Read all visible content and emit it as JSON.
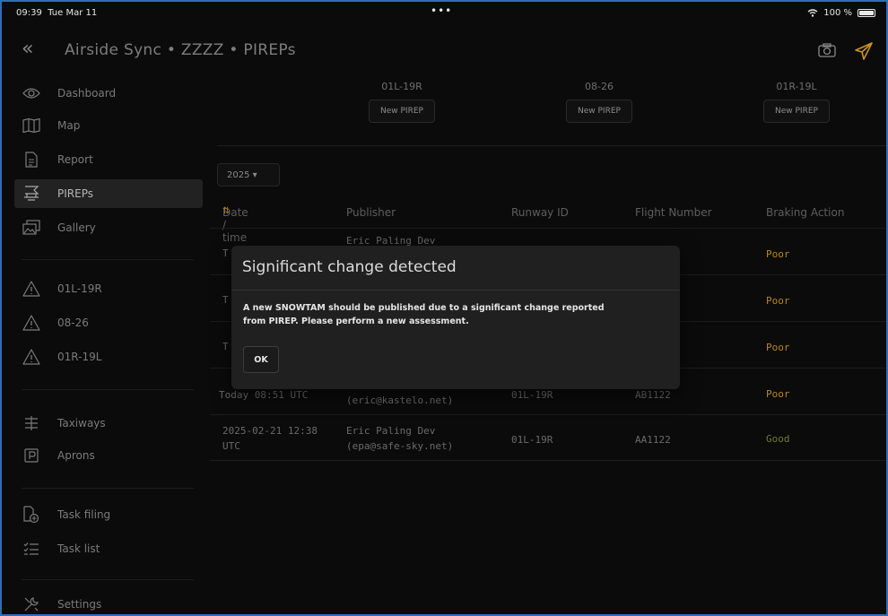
{
  "status": {
    "time": "09:39",
    "date": "Tue Mar 11",
    "dots": "•••",
    "battery": "100 %"
  },
  "nav": {
    "title": "Airside Sync • ZZZZ • PIREPs"
  },
  "sidebar": {
    "items": [
      {
        "label": "Dashboard",
        "icon": "eye-icon"
      },
      {
        "label": "Map",
        "icon": "map-icon"
      },
      {
        "label": "Report",
        "icon": "report-icon"
      },
      {
        "label": "PIREPs",
        "icon": "pirep-icon",
        "active": true
      },
      {
        "label": "Gallery",
        "icon": "gallery-icon"
      },
      {
        "label": "01L-19R",
        "icon": "warning-icon"
      },
      {
        "label": "08-26",
        "icon": "warning-icon"
      },
      {
        "label": "01R-19L",
        "icon": "warning-icon"
      },
      {
        "label": "Taxiways",
        "icon": "taxiway-icon"
      },
      {
        "label": "Aprons",
        "icon": "apron-icon"
      },
      {
        "label": "Task filing",
        "icon": "task-filing-icon"
      },
      {
        "label": "Task list",
        "icon": "task-list-icon"
      },
      {
        "label": "Settings",
        "icon": "settings-icon"
      }
    ]
  },
  "runways": [
    {
      "name": "01L-19R",
      "button": "New PIREP"
    },
    {
      "name": "08-26",
      "button": "New PIREP"
    },
    {
      "name": "01R-19L",
      "button": "New PIREP"
    }
  ],
  "year_select": "2025 ▾",
  "table": {
    "headers": [
      "Date / time",
      "Publisher",
      "Runway ID",
      "Flight Number",
      "Braking Action"
    ],
    "rows": [
      {
        "date": "T",
        "publisher": "Eric Paling Dev",
        "email": "",
        "runway": "",
        "flight": "",
        "braking": "Poor"
      },
      {
        "date": "T",
        "publisher": "",
        "email": "",
        "runway": "",
        "flight": "",
        "braking": "Poor"
      },
      {
        "date": "T",
        "publisher": "",
        "email": "",
        "runway": "",
        "flight": "",
        "braking": "Poor"
      },
      {
        "date": "Today 08:51 UTC",
        "publisher": "",
        "email": "(eric@kastelo.net)",
        "runway": "01L-19R",
        "flight": "AB1122",
        "braking": "Poor"
      },
      {
        "date": "2025-02-21 12:38",
        "date2": "UTC",
        "publisher": "Eric Paling Dev",
        "email": "(epa@safe-sky.net)",
        "runway": "01L-19R",
        "flight": "AA1122",
        "braking": "Good"
      }
    ]
  },
  "modal": {
    "title": "Significant change detected",
    "body_line1": "A new SNOWTAM should be published due to a significant change reported",
    "body_line2": "from PIREP. Please perform a new assessment.",
    "ok": "OK"
  },
  "colors": {
    "poor": "#b9861b",
    "good": "#6f7d2c",
    "accent": "#c9941f"
  }
}
